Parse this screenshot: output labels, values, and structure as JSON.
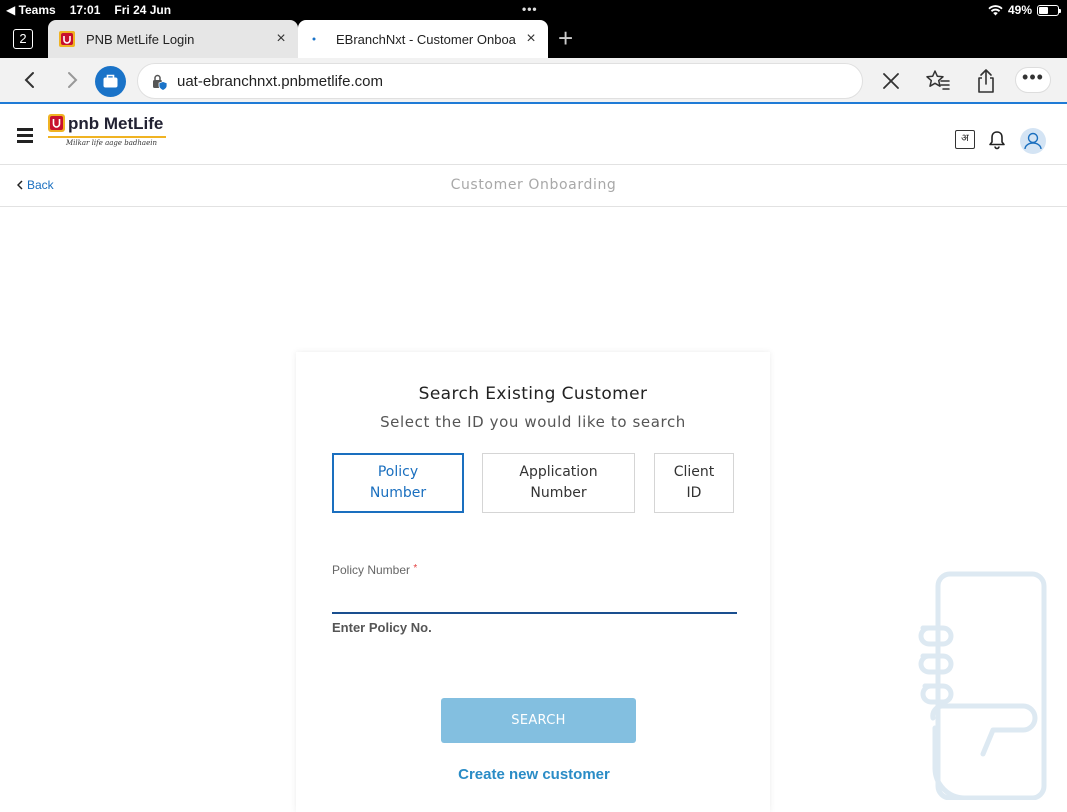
{
  "status_bar": {
    "back_app": "◀ Teams",
    "time": "17:01",
    "date": "Fri 24 Jun",
    "battery": "49%"
  },
  "browser": {
    "tab_count": "2",
    "tabs": [
      {
        "title": "PNB MetLife Login",
        "close": "×"
      },
      {
        "title": "EBranchNxt - Customer Onboa",
        "close": "×"
      }
    ],
    "new_tab": "+",
    "url": "uat-ebranchnxt.pnbmetlife.com",
    "more": "•••"
  },
  "app_header": {
    "brand": "pnb MetLife",
    "tagline": "Milkar life aage badhaein",
    "language_icon_text": "अ"
  },
  "sub_header": {
    "back_label": "Back",
    "title": "Customer Onboarding"
  },
  "search_card": {
    "title": "Search Existing Customer",
    "subtitle": "Select the ID you would like to search",
    "id_options": [
      {
        "label_line1": "Policy",
        "label_line2": "Number",
        "selected": true
      },
      {
        "label_line1": "Application",
        "label_line2": "Number",
        "selected": false
      },
      {
        "label_line1": "Client",
        "label_line2": "ID",
        "selected": false
      }
    ],
    "field_label": "Policy Number",
    "required_mark": "*",
    "field_value": "",
    "field_hint": "Enter Policy No.",
    "search_button": "SEARCH",
    "create_link": "Create new customer"
  },
  "colors": {
    "accent_blue": "#1a6fbf",
    "search_button_bg": "#83bfe0",
    "link": "#2a8cc6",
    "brand_yellow": "#f0b323"
  }
}
